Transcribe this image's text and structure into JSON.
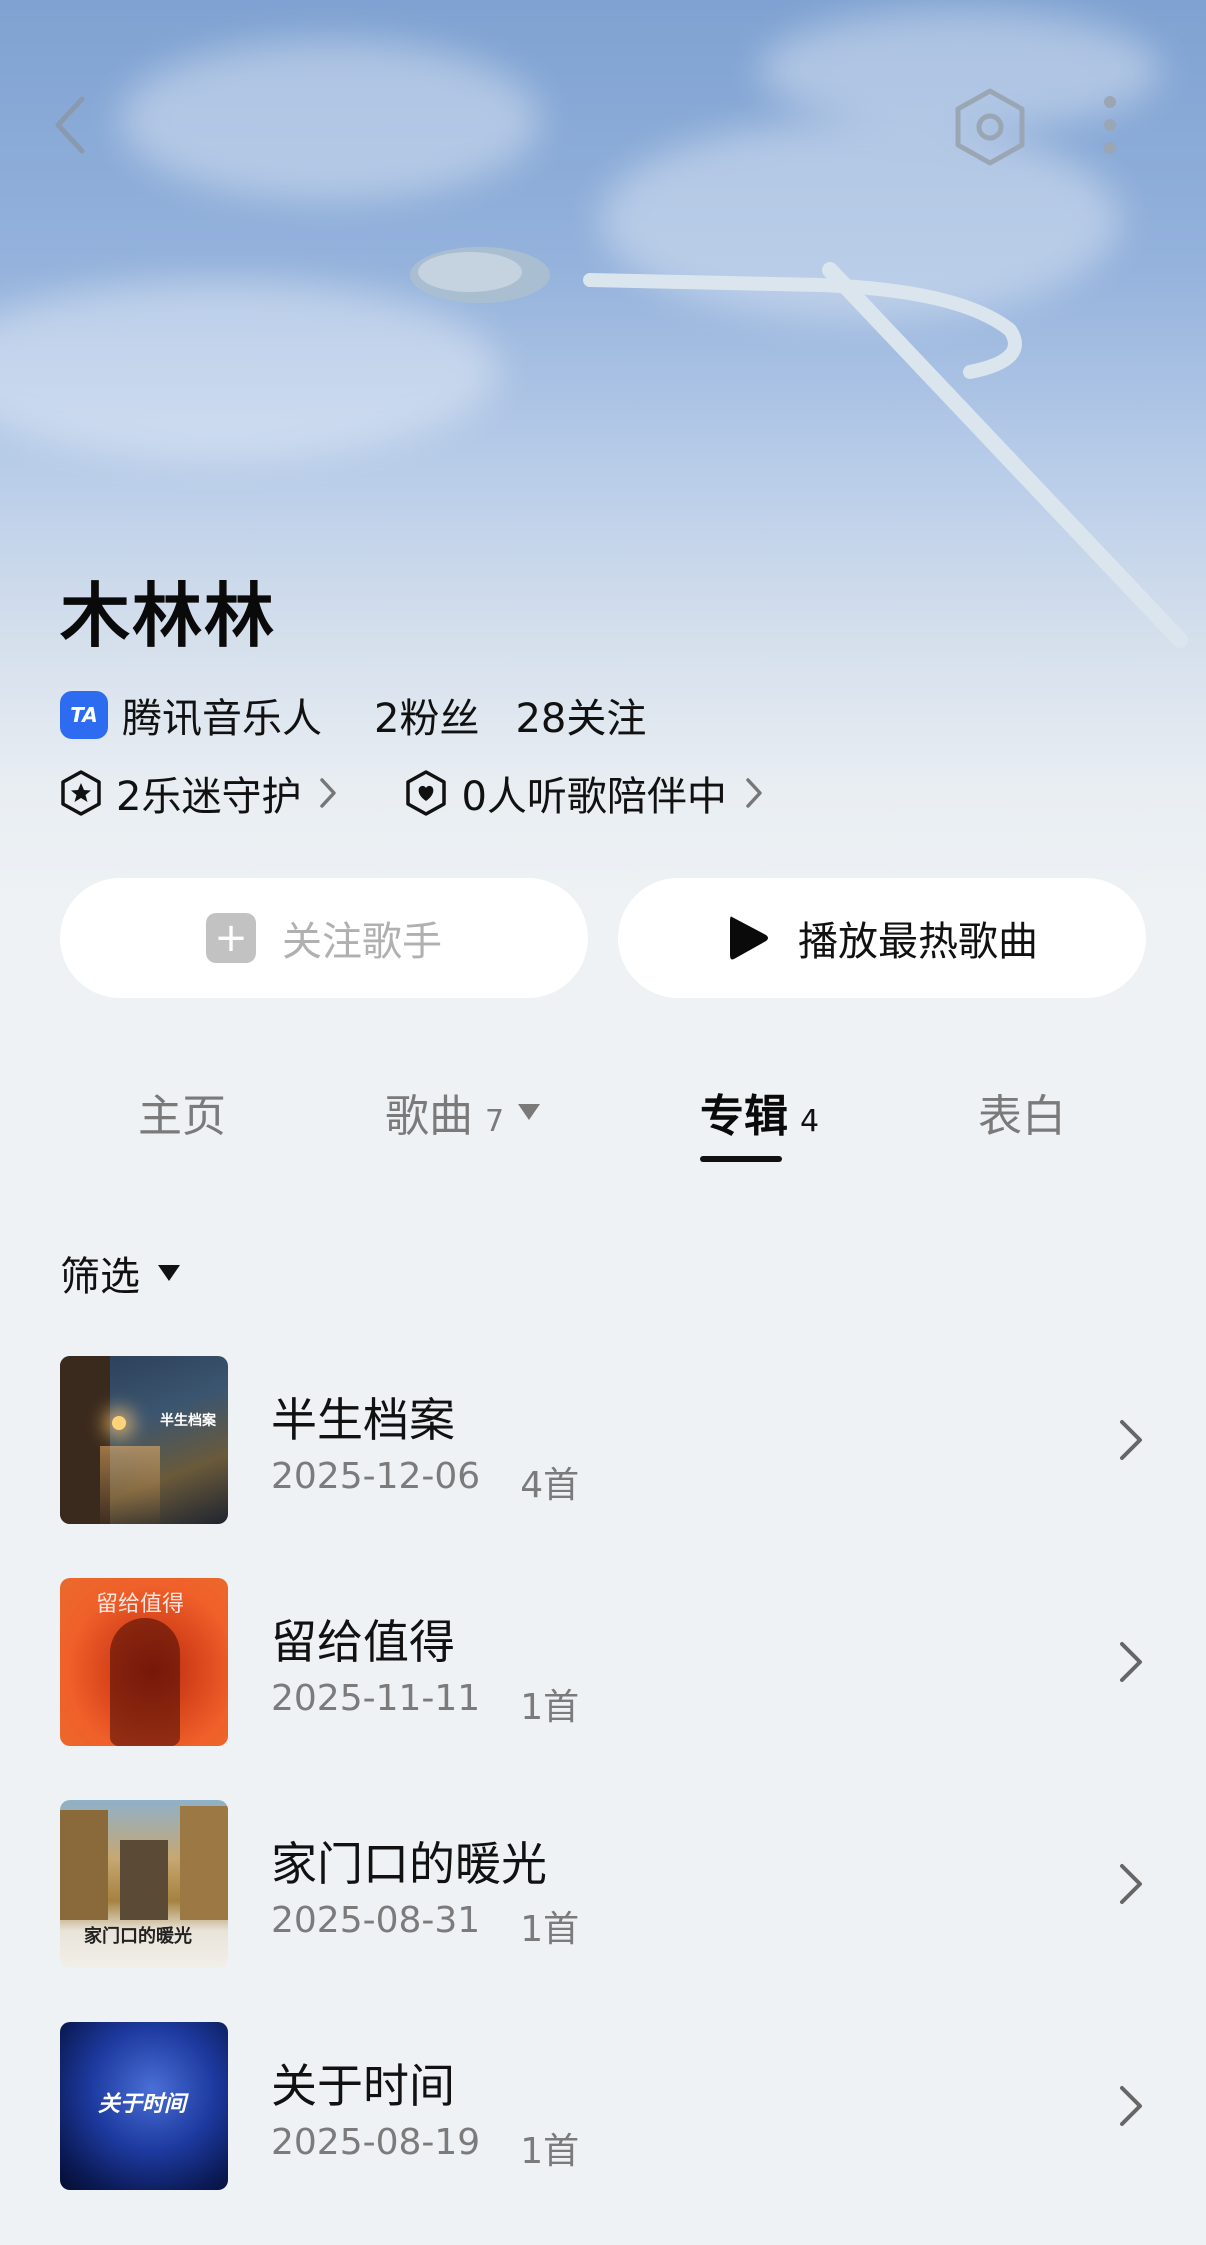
{
  "artist": {
    "name": "木林林",
    "badge": "腾讯音乐人",
    "fans": "2粉丝",
    "following": "28关注",
    "guard": "2乐迷守护",
    "accompany": "0人听歌陪伴中"
  },
  "actions": {
    "follow_label": "关注歌手",
    "play_label": "播放最热歌曲"
  },
  "tabs": [
    {
      "label": "主页",
      "count": ""
    },
    {
      "label": "歌曲",
      "count": "7"
    },
    {
      "label": "专辑",
      "count": "4"
    },
    {
      "label": "表白",
      "count": ""
    }
  ],
  "active_tab": "专辑",
  "filter_label": "筛选",
  "albums": [
    {
      "title": "半生档案",
      "date": "2025-12-06",
      "tracks": "4首",
      "cover_text": "半生档案"
    },
    {
      "title": "留给值得",
      "date": "2025-11-11",
      "tracks": "1首",
      "cover_text": "留给值得"
    },
    {
      "title": "家门口的暖光",
      "date": "2025-08-31",
      "tracks": "1首",
      "cover_text": "家门口的暖光"
    },
    {
      "title": "关于时间",
      "date": "2025-08-19",
      "tracks": "1首",
      "cover_text": "关于时间"
    }
  ],
  "colors": {
    "tme_blue": "#2d6cf0",
    "sky_top": "#7fa2d2",
    "page_bg": "#eef2f4"
  },
  "icons": [
    "back-arrow-icon",
    "hexagon-settings-icon",
    "more-vertical-icon",
    "star-shield-icon",
    "heart-shield-icon",
    "chevron-right-icon",
    "play-icon",
    "plus-icon",
    "caret-down-icon"
  ]
}
